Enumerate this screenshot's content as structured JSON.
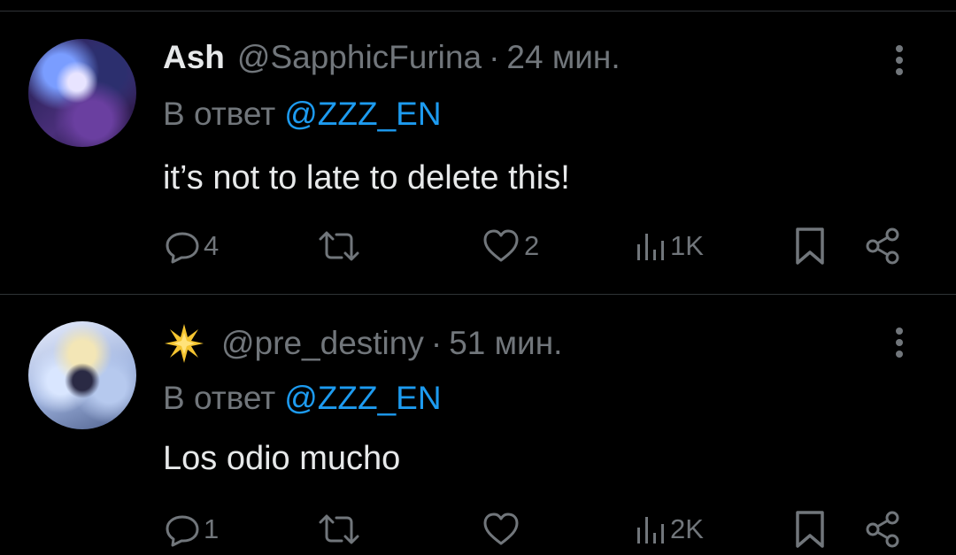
{
  "tweets": [
    {
      "display_name": "Ash",
      "handle": "@SapphicFurina",
      "separator": "·",
      "time": "24 мин.",
      "reply_prefix": "В ответ",
      "reply_to": "@ZZZ_EN",
      "text": "it’s not to late to delete this!",
      "replies": "4",
      "retweets": "",
      "likes": "2",
      "views": "1K"
    },
    {
      "display_name_emoji": "star-emoji",
      "handle": "@pre_destiny",
      "separator": "·",
      "time": "51 мин.",
      "reply_prefix": "В ответ",
      "reply_to": "@ZZZ_EN",
      "text": "Los odio mucho",
      "replies": "1",
      "retweets": "",
      "likes": "",
      "views": "2K"
    }
  ],
  "colors": {
    "background": "#000000",
    "text": "#e7e9ea",
    "secondary": "#71767b",
    "link": "#1d9bf0",
    "divider": "#2f3336"
  }
}
